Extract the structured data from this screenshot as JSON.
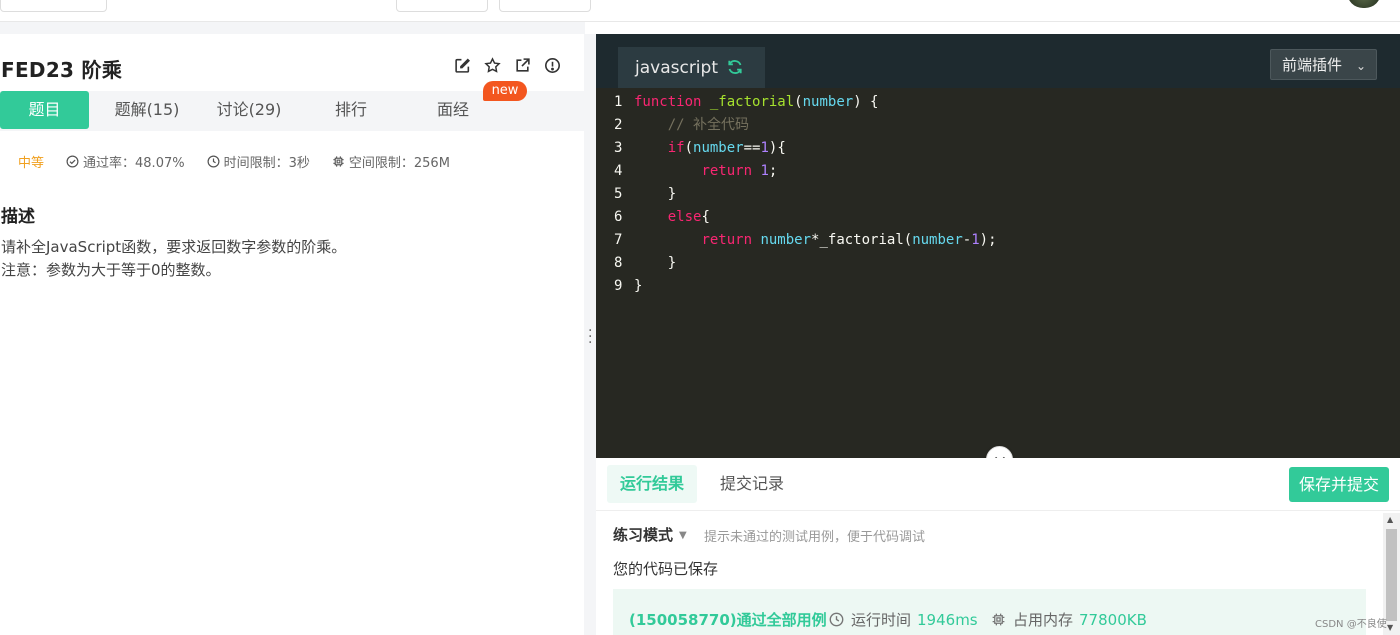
{
  "question": {
    "title": "FED23  阶乘",
    "tabs": [
      "题目",
      "题解(15)",
      "讨论(29)",
      "排行",
      "面经"
    ],
    "new_badge": "new",
    "difficulty": "中等",
    "pass_rate": "通过率：48.07%",
    "time_limit": "时间限制：3秒",
    "space_limit": "空间限制：256M",
    "desc_heading": "描述",
    "desc_line1": "请补全JavaScript函数，要求返回数字参数的阶乘。",
    "desc_line2": "注意：参数为大于等于0的整数。"
  },
  "editor": {
    "language": "javascript",
    "plugin_label": "前端插件",
    "line_numbers": [
      "1",
      "2",
      "3",
      "4",
      "5",
      "6",
      "7",
      "8",
      "9"
    ]
  },
  "results": {
    "tab_result": "运行结果",
    "tab_history": "提交记录",
    "submit_label": "保存并提交",
    "mode_label": "练习模式",
    "mode_hint": "提示未通过的测试用例，便于代码调试",
    "saved_msg": "您的代码已保存",
    "pass_msg": "(150058770)通过全部用例",
    "runtime_label": "运行时间",
    "runtime_value": "1946ms",
    "memory_label": "占用内存",
    "memory_value": "77800KB"
  },
  "watermark": "CSDN @不良使",
  "colors": {
    "accent": "#32ca99",
    "badge": "#f3561f",
    "editor_bg": "#272822"
  }
}
